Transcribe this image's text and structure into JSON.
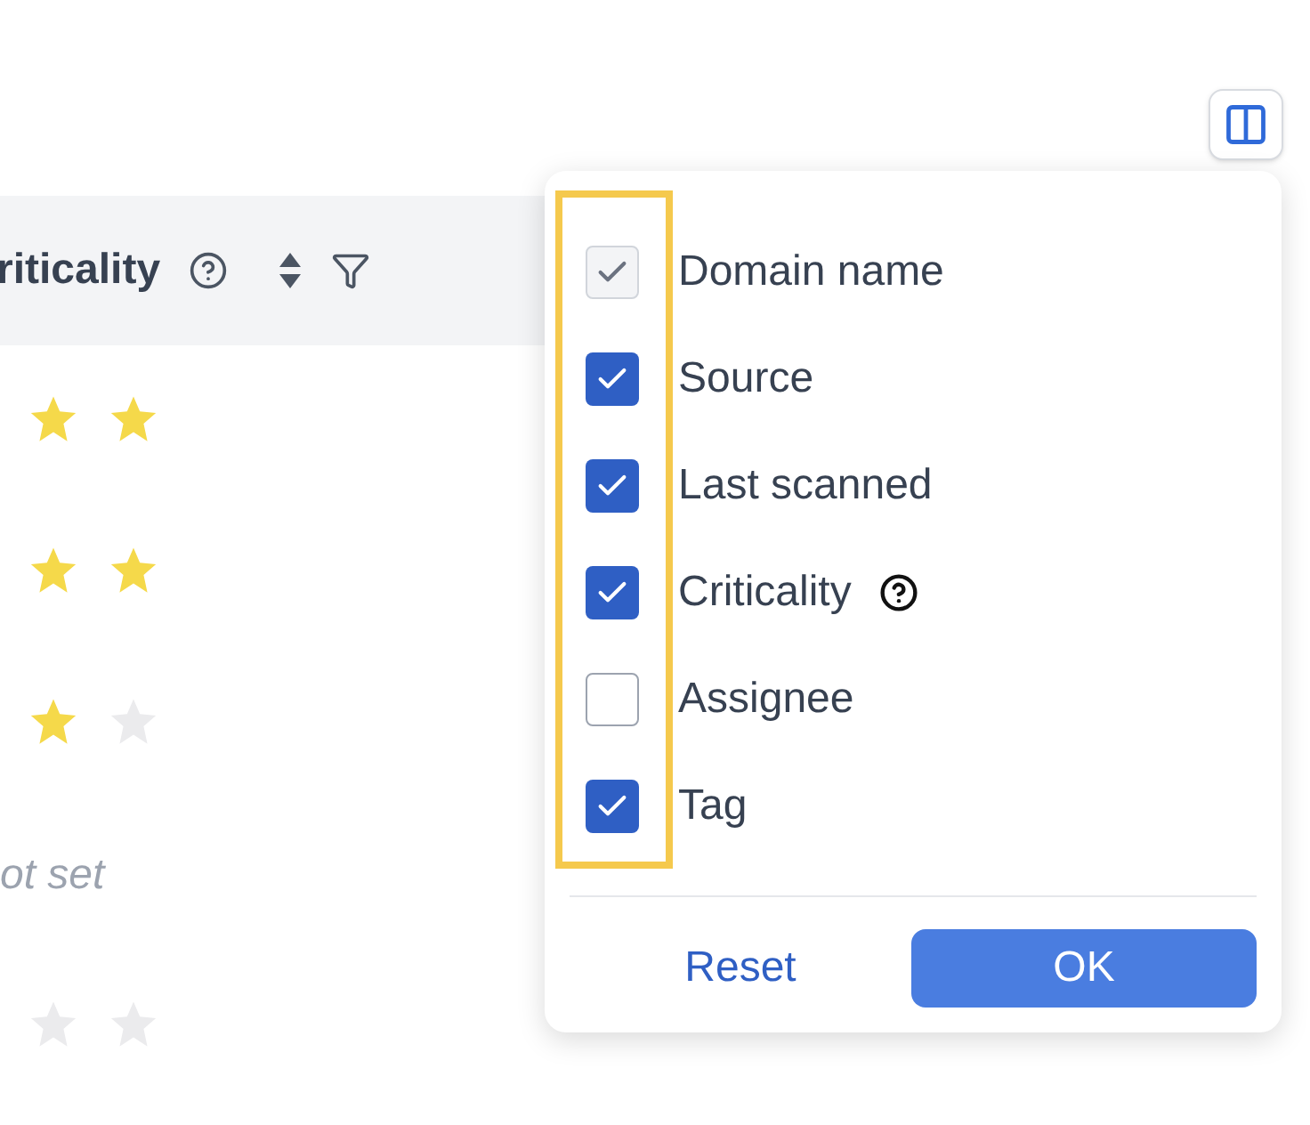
{
  "table": {
    "header": {
      "label": "riticality"
    },
    "rows": [
      {
        "kind": "rating",
        "marks": [
          {
            "filled": true
          },
          {
            "filled": true
          }
        ]
      },
      {
        "kind": "rating",
        "marks": [
          {
            "filled": true
          },
          {
            "filled": true
          }
        ]
      },
      {
        "kind": "rating",
        "marks": [
          {
            "filled": true
          },
          {
            "filled": false
          }
        ]
      },
      {
        "kind": "text",
        "text": "ot set"
      },
      {
        "kind": "rating",
        "marks": [
          {
            "filled": false
          },
          {
            "filled": false
          }
        ]
      }
    ]
  },
  "column_picker": {
    "items": [
      {
        "label": "Domain name",
        "checked": true,
        "disabled": true,
        "help": false
      },
      {
        "label": "Source",
        "checked": true,
        "disabled": false,
        "help": false
      },
      {
        "label": "Last scanned",
        "checked": true,
        "disabled": false,
        "help": false
      },
      {
        "label": "Criticality",
        "checked": true,
        "disabled": false,
        "help": true
      },
      {
        "label": "Assignee",
        "checked": false,
        "disabled": false,
        "help": false
      },
      {
        "label": "Tag",
        "checked": true,
        "disabled": false,
        "help": false
      }
    ],
    "buttons": [
      {
        "kind": "link",
        "label": "Reset"
      },
      {
        "kind": "primary",
        "label": "OK"
      }
    ]
  }
}
